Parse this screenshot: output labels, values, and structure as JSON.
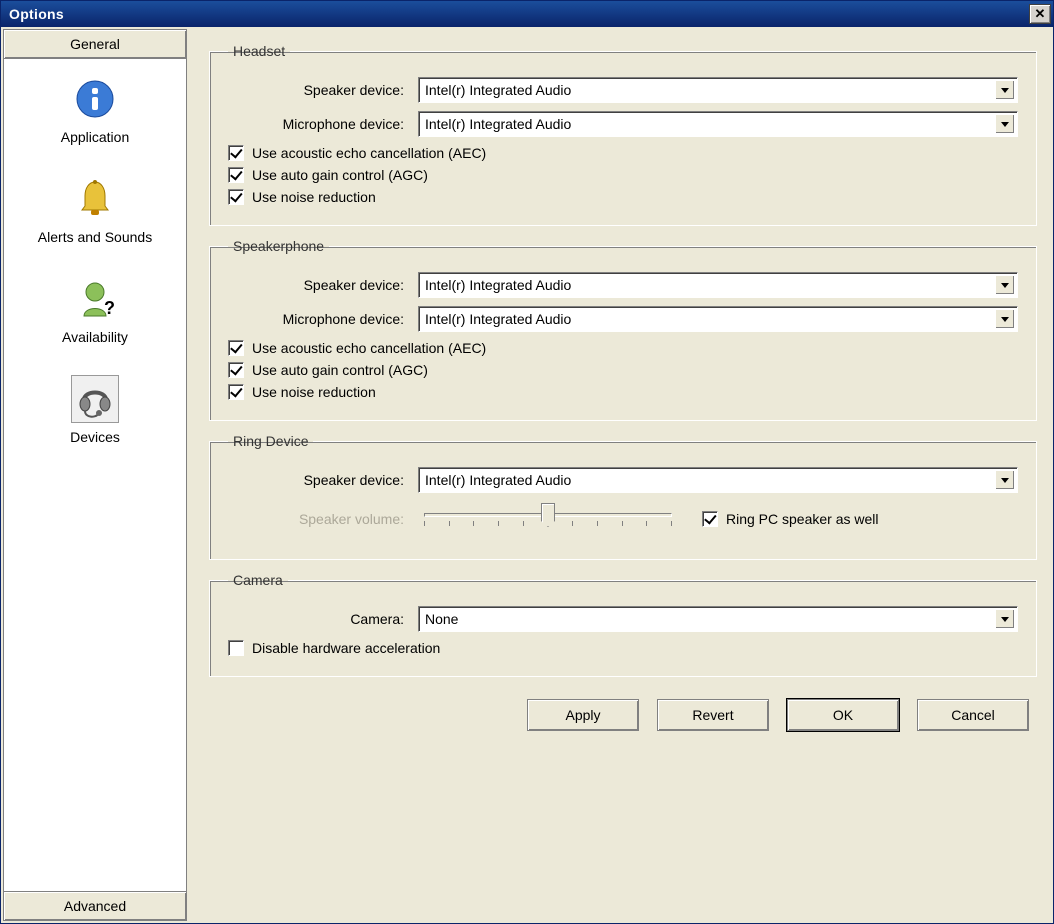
{
  "window": {
    "title": "Options"
  },
  "sidebar": {
    "category_general": "General",
    "category_advanced": "Advanced",
    "items": [
      {
        "label": "Application"
      },
      {
        "label": "Alerts and Sounds"
      },
      {
        "label": "Availability"
      },
      {
        "label": "Devices"
      }
    ]
  },
  "groups": {
    "headset": {
      "legend": "Headset",
      "speaker_label": "Speaker device:",
      "speaker_value": "Intel(r) Integrated Audio",
      "mic_label": "Microphone device:",
      "mic_value": "Intel(r) Integrated Audio",
      "aec_label": "Use acoustic echo cancellation (AEC)",
      "aec_checked": true,
      "agc_label": "Use auto gain control (AGC)",
      "agc_checked": true,
      "nr_label": "Use noise reduction",
      "nr_checked": true
    },
    "speakerphone": {
      "legend": "Speakerphone",
      "speaker_label": "Speaker device:",
      "speaker_value": "Intel(r) Integrated Audio",
      "mic_label": "Microphone device:",
      "mic_value": "Intel(r) Integrated Audio",
      "aec_label": "Use acoustic echo cancellation (AEC)",
      "aec_checked": true,
      "agc_label": "Use auto gain control (AGC)",
      "agc_checked": true,
      "nr_label": "Use noise reduction",
      "nr_checked": true
    },
    "ring": {
      "legend": "Ring Device",
      "speaker_label": "Speaker device:",
      "speaker_value": "Intel(r) Integrated Audio",
      "volume_label": "Speaker volume:",
      "ring_pc_label": "Ring PC speaker as well",
      "ring_pc_checked": true
    },
    "camera": {
      "legend": "Camera",
      "camera_label": "Camera:",
      "camera_value": "None",
      "disable_hw_label": "Disable hardware acceleration",
      "disable_hw_checked": false
    }
  },
  "buttons": {
    "apply": "Apply",
    "revert": "Revert",
    "ok": "OK",
    "cancel": "Cancel"
  }
}
